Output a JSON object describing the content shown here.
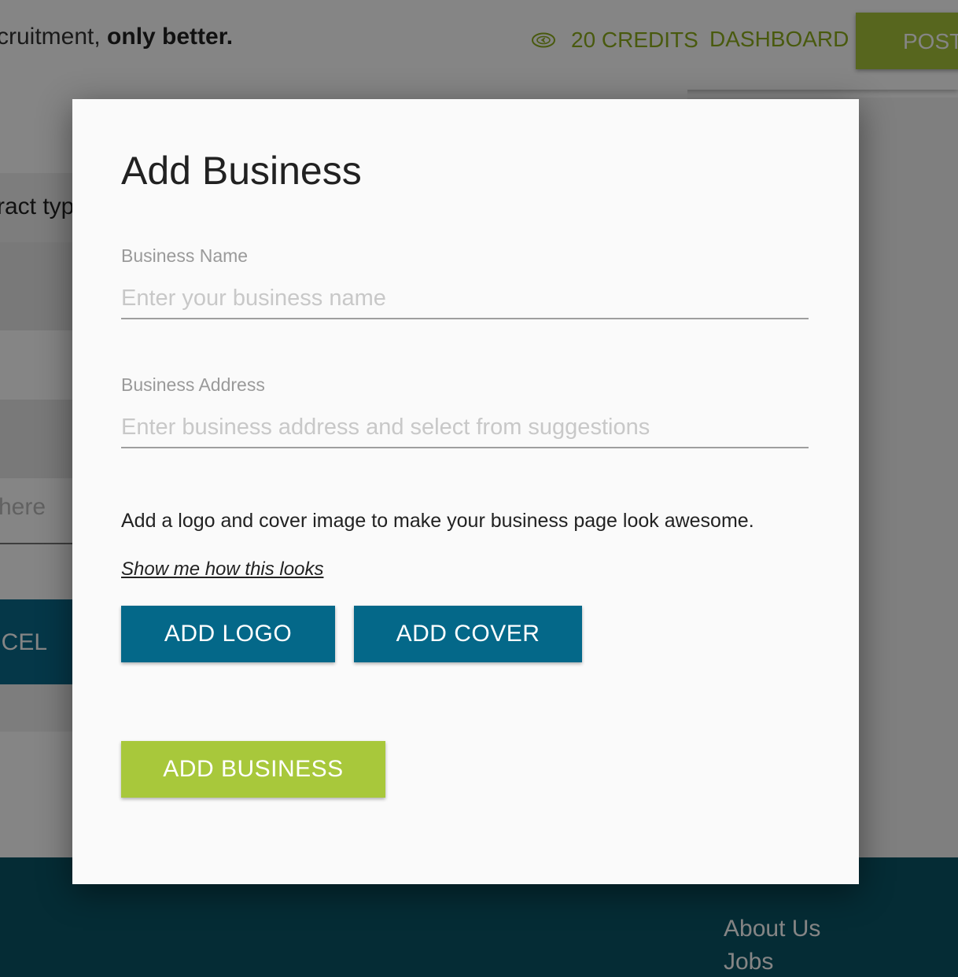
{
  "header": {
    "tagline_prefix": "cruitment, ",
    "tagline_bold": "only better.",
    "credits_label": "20 CREDITS",
    "dashboard_label": "DASHBOARD",
    "post_label": "POST"
  },
  "background": {
    "contract_text": "ract typ",
    "here_text": "here",
    "cancel_label": "NCEL"
  },
  "footer": {
    "links": [
      "About Us",
      "Jobs"
    ]
  },
  "modal": {
    "title": "Add Business",
    "business_name": {
      "label": "Business Name",
      "placeholder": "Enter your business name",
      "value": ""
    },
    "business_address": {
      "label": "Business Address",
      "placeholder": "Enter business address and select from suggestions",
      "value": ""
    },
    "hint": "Add a logo and cover image to make your business page look awesome.",
    "show_link": "Show me how this looks",
    "add_logo_label": "ADD LOGO",
    "add_cover_label": "ADD COVER",
    "submit_label": "ADD BUSINESS"
  },
  "colors": {
    "accent_green": "#a8c83b",
    "primary_blue": "#046889",
    "footer_teal": "#0a5566"
  },
  "icons": {
    "credits": "coin-icon"
  }
}
